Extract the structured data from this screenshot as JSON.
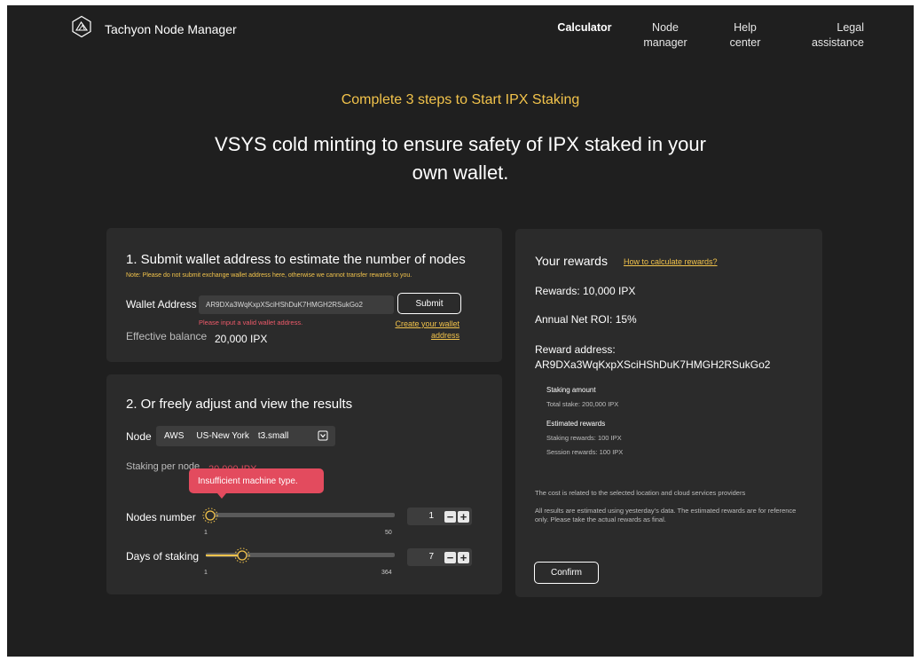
{
  "header": {
    "app_name": "Tachyon Node Manager",
    "nav": [
      {
        "line1": "Calculator",
        "line2": ""
      },
      {
        "line1": "Node",
        "line2": "manager"
      },
      {
        "line1": "Help",
        "line2": "center"
      },
      {
        "line1": "Legal",
        "line2": "assistance"
      }
    ]
  },
  "hero": {
    "subtitle": "Complete 3 steps to Start IPX Staking",
    "title_line1": "VSYS cold minting to ensure safety of IPX staked in your",
    "title_line2": "own wallet."
  },
  "step1": {
    "title": "1. Submit wallet address to estimate the number of nodes",
    "note": "Note: Please do not submit exchange wallet address here, otherwise we cannot transfer rewards to you.",
    "wallet_label": "Wallet Address",
    "wallet_value": "AR9DXa3WqKxpXSciHShDuK7HMGH2RSukGo2",
    "error": "Please input a valid wallet address.",
    "submit_label": "Submit",
    "create_link_line1": "Create your wallet",
    "create_link_line2": "address",
    "balance_label": "Effective balance",
    "balance_value": "20,000 IPX"
  },
  "step2": {
    "title": "2. Or freely adjust and view the results",
    "node_label": "Node",
    "node_provider": "AWS",
    "node_region": "US-New York",
    "node_type": "t3.small",
    "staking_per_node_label": "Staking per node",
    "staking_per_node_value": "20,000 IPX",
    "tooltip": "Insufficient machine type.",
    "nodes_label": "Nodes number",
    "nodes_value": "1",
    "nodes_min": "1",
    "nodes_max": "50",
    "days_label": "Days of staking",
    "days_value": "7",
    "days_min": "1",
    "days_max": "364",
    "minus": "−",
    "plus": "+"
  },
  "rewards": {
    "title": "Your rewards",
    "how_link": "How to calculate rewards?",
    "rewards_line": "Rewards: 10,000 IPX",
    "roi_line": "Annual Net ROI: 15%",
    "address_label": "Reward address:",
    "address_value": "AR9DXa3WqKxpXSciHShDuK7HMGH2RSukGo2",
    "staking_amount_h": "Staking amount",
    "total_stake": "Total stake: 200,000 IPX",
    "estimated_h": "Estimated rewards",
    "staking_rewards": "Staking rewards:  100 IPX",
    "session_rewards": "Session rewards: 100 IPX",
    "cost_note": "The cost is related to the selected location and cloud services providers",
    "disclaimer": "All results are estimated using yesterday's data. The estimated rewards are for reference only. Please take the actual rewards as final.",
    "confirm_label": "Confirm"
  },
  "colors": {
    "background": "#1f1f1f",
    "card": "#2b2b2b",
    "accent": "#f2c34b",
    "error": "#e34b5e"
  },
  "icons": {
    "logo": "triangle-mountain-logo",
    "select": "dropdown-icon",
    "knob": "sun-knob-icon"
  }
}
